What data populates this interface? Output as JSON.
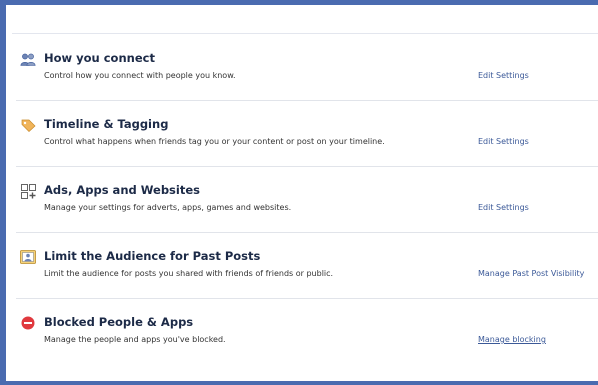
{
  "sections": [
    {
      "icon": "people-icon",
      "title": "How you connect",
      "description": "Control how you connect with people you know.",
      "action": "Edit Settings"
    },
    {
      "icon": "tag-icon",
      "title": "Timeline & Tagging",
      "description": "Control what happens when friends tag you or your content or post on your timeline.",
      "action": "Edit Settings"
    },
    {
      "icon": "apps-icon",
      "title": "Ads, Apps and Websites",
      "description": "Manage your settings for adverts, apps, games and websites.",
      "action": "Edit Settings"
    },
    {
      "icon": "limit-audience-icon",
      "title": "Limit the Audience for Past Posts",
      "description": "Limit the audience for posts you shared with friends of friends or public.",
      "action": "Manage Past Post Visibility"
    },
    {
      "icon": "blocked-icon",
      "title": "Blocked People & Apps",
      "description": "Manage the people and apps you've blocked.",
      "action": "Manage blocking"
    }
  ],
  "colors": {
    "frame": "#4a6bb0",
    "link": "#3b5998",
    "title": "#1c2a47",
    "blocked": "#e0393e",
    "tag": "#f0b45a"
  }
}
